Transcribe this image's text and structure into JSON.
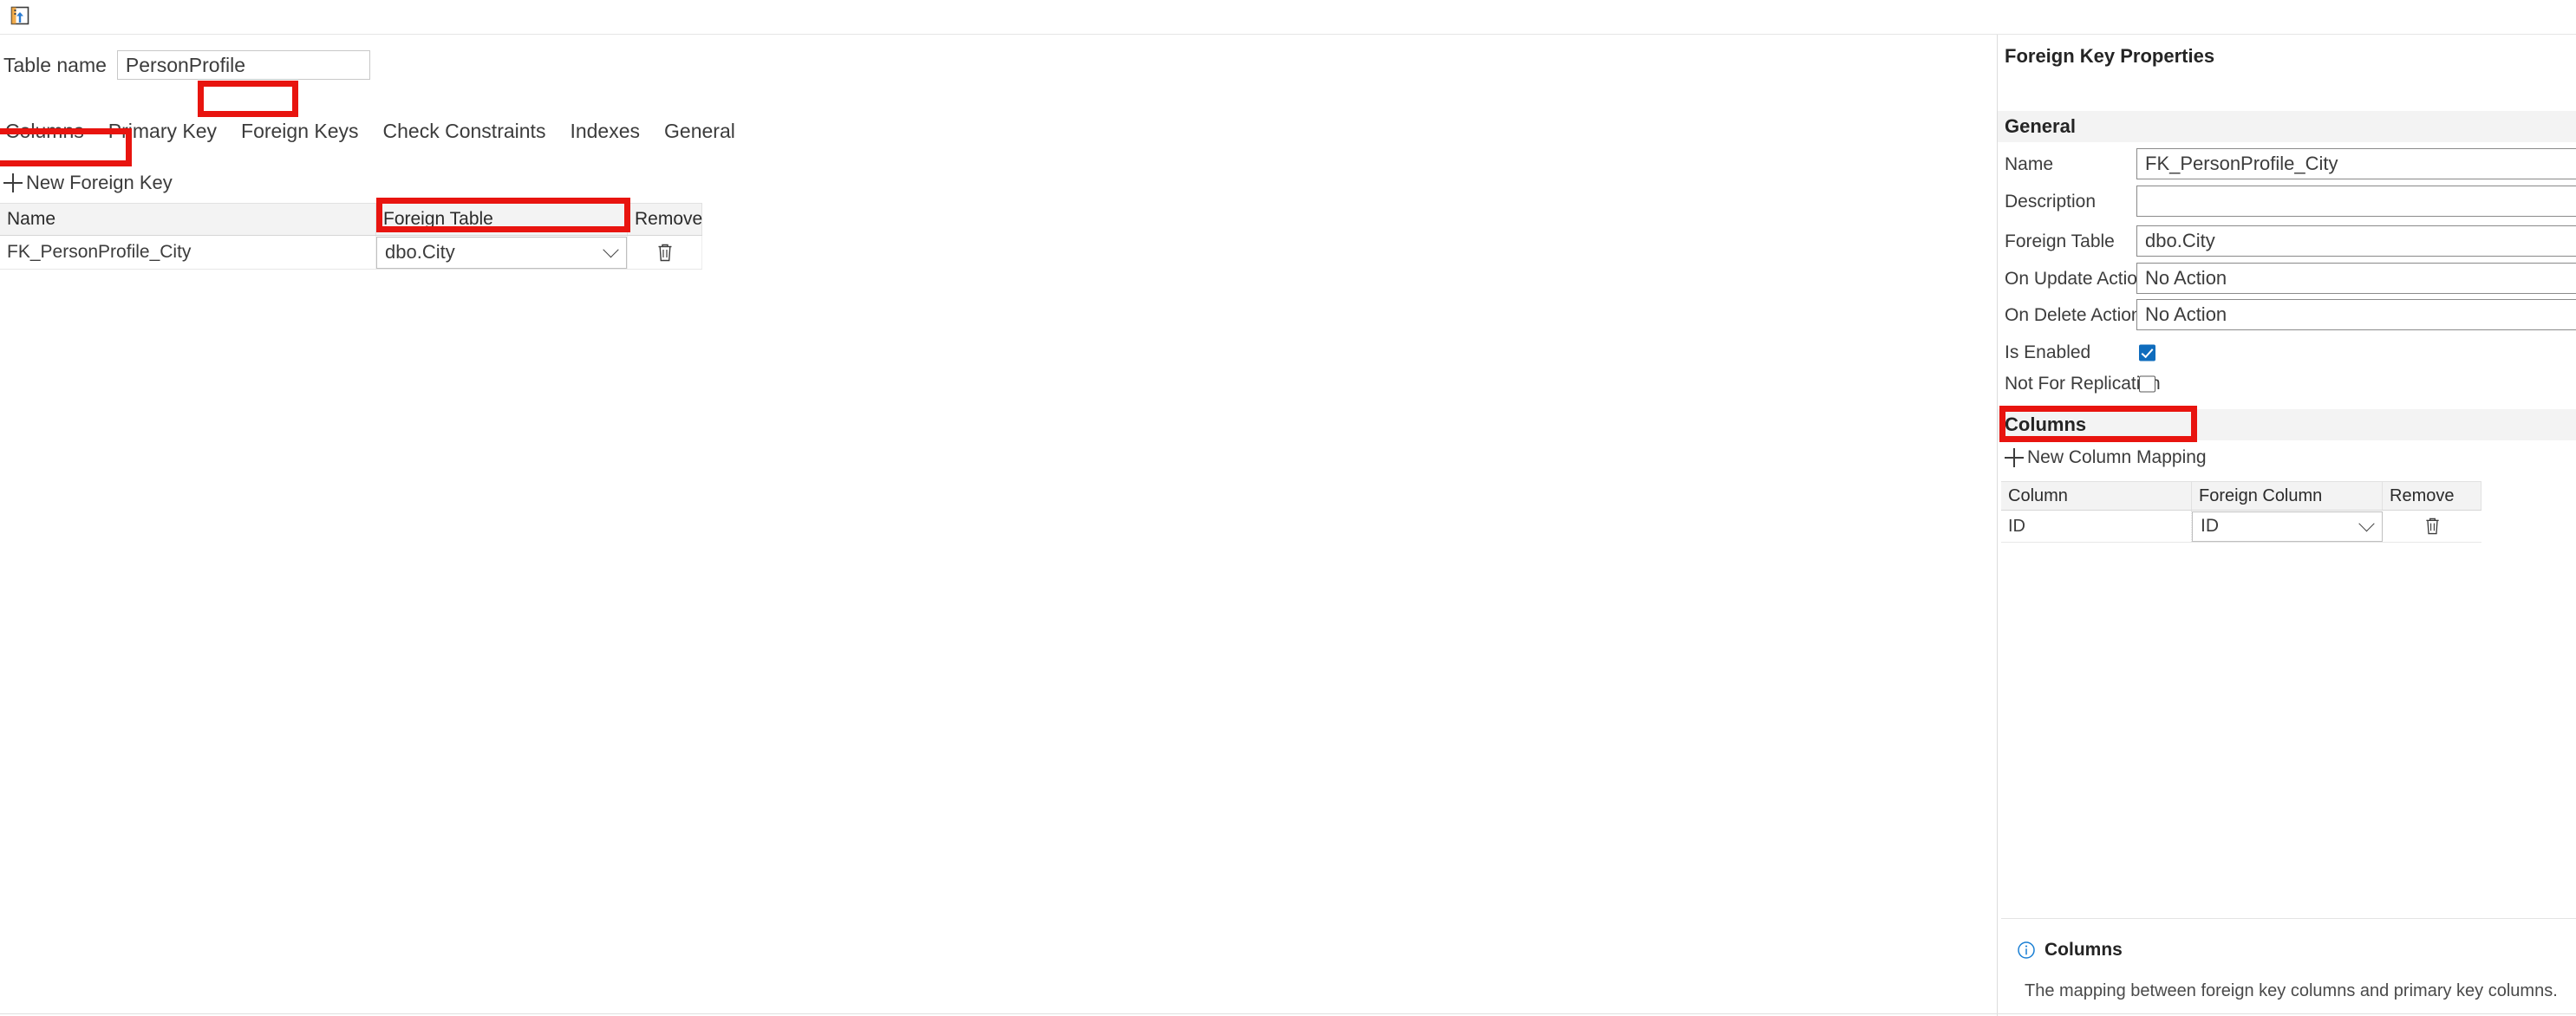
{
  "toolbar": {
    "publish_icon": "publish-changes-icon",
    "publish_tooltip": "Publish Changes"
  },
  "main": {
    "table_name_label": "Table name",
    "table_name_value": "PersonProfile",
    "table_name_placeholder": "Table name",
    "tabs": [
      {
        "label": "Columns",
        "selected": false
      },
      {
        "label": "Primary Key",
        "selected": false
      },
      {
        "label": "Foreign Keys",
        "selected": true
      },
      {
        "label": "Check Constraints",
        "selected": false
      },
      {
        "label": "Indexes",
        "selected": false
      },
      {
        "label": "General",
        "selected": false
      }
    ],
    "new_foreign_key_label": "New Foreign Key",
    "new_foreign_key_icon": "plus-icon",
    "fk_grid": {
      "headers": [
        "Name",
        "Foreign Table",
        "Remove"
      ],
      "rows": [
        {
          "name": "FK_PersonProfile_City",
          "foreign_table": "dbo.City",
          "remove_icon": "trash-icon"
        }
      ]
    }
  },
  "properties": {
    "title": "Foreign Key Properties",
    "general_section_label": "General",
    "fields": [
      {
        "label": "Name",
        "value": "FK_PersonProfile_City"
      },
      {
        "label": "Description",
        "value": ""
      },
      {
        "label": "Foreign Table",
        "value": "dbo.City"
      },
      {
        "label": "On Update Action",
        "value": "No Action"
      },
      {
        "label": "On Delete Action",
        "value": "No Action"
      }
    ],
    "checkboxes": [
      {
        "label": "Is Enabled",
        "checked": true
      },
      {
        "label": "Not For Replication",
        "checked": false
      }
    ],
    "columns_section_label": "Columns",
    "new_column_mapping_label": "New Column Mapping",
    "new_column_mapping_icon": "plus-icon",
    "columns_grid": {
      "headers": [
        "Column",
        "Foreign Column",
        "Remove"
      ],
      "rows": [
        {
          "column": "ID",
          "foreign_column": "ID",
          "remove_icon": "trash-icon"
        }
      ]
    },
    "help": {
      "icon": "info-icon",
      "title": "Columns",
      "text": "The mapping between foreign key columns and primary key columns."
    }
  },
  "annotations": {
    "color": "#e8140f",
    "highlights": [
      "foreign-keys-tab",
      "new-foreign-key-button",
      "foreign-table-cell-dropdown",
      "new-column-mapping-button"
    ]
  },
  "colors": {
    "accent": "#0f6cbd",
    "header_bg": "#f3f3f3",
    "text": "#3c3c3c",
    "annotation_red": "#e8140f",
    "info_blue": "#1a7fd4"
  }
}
